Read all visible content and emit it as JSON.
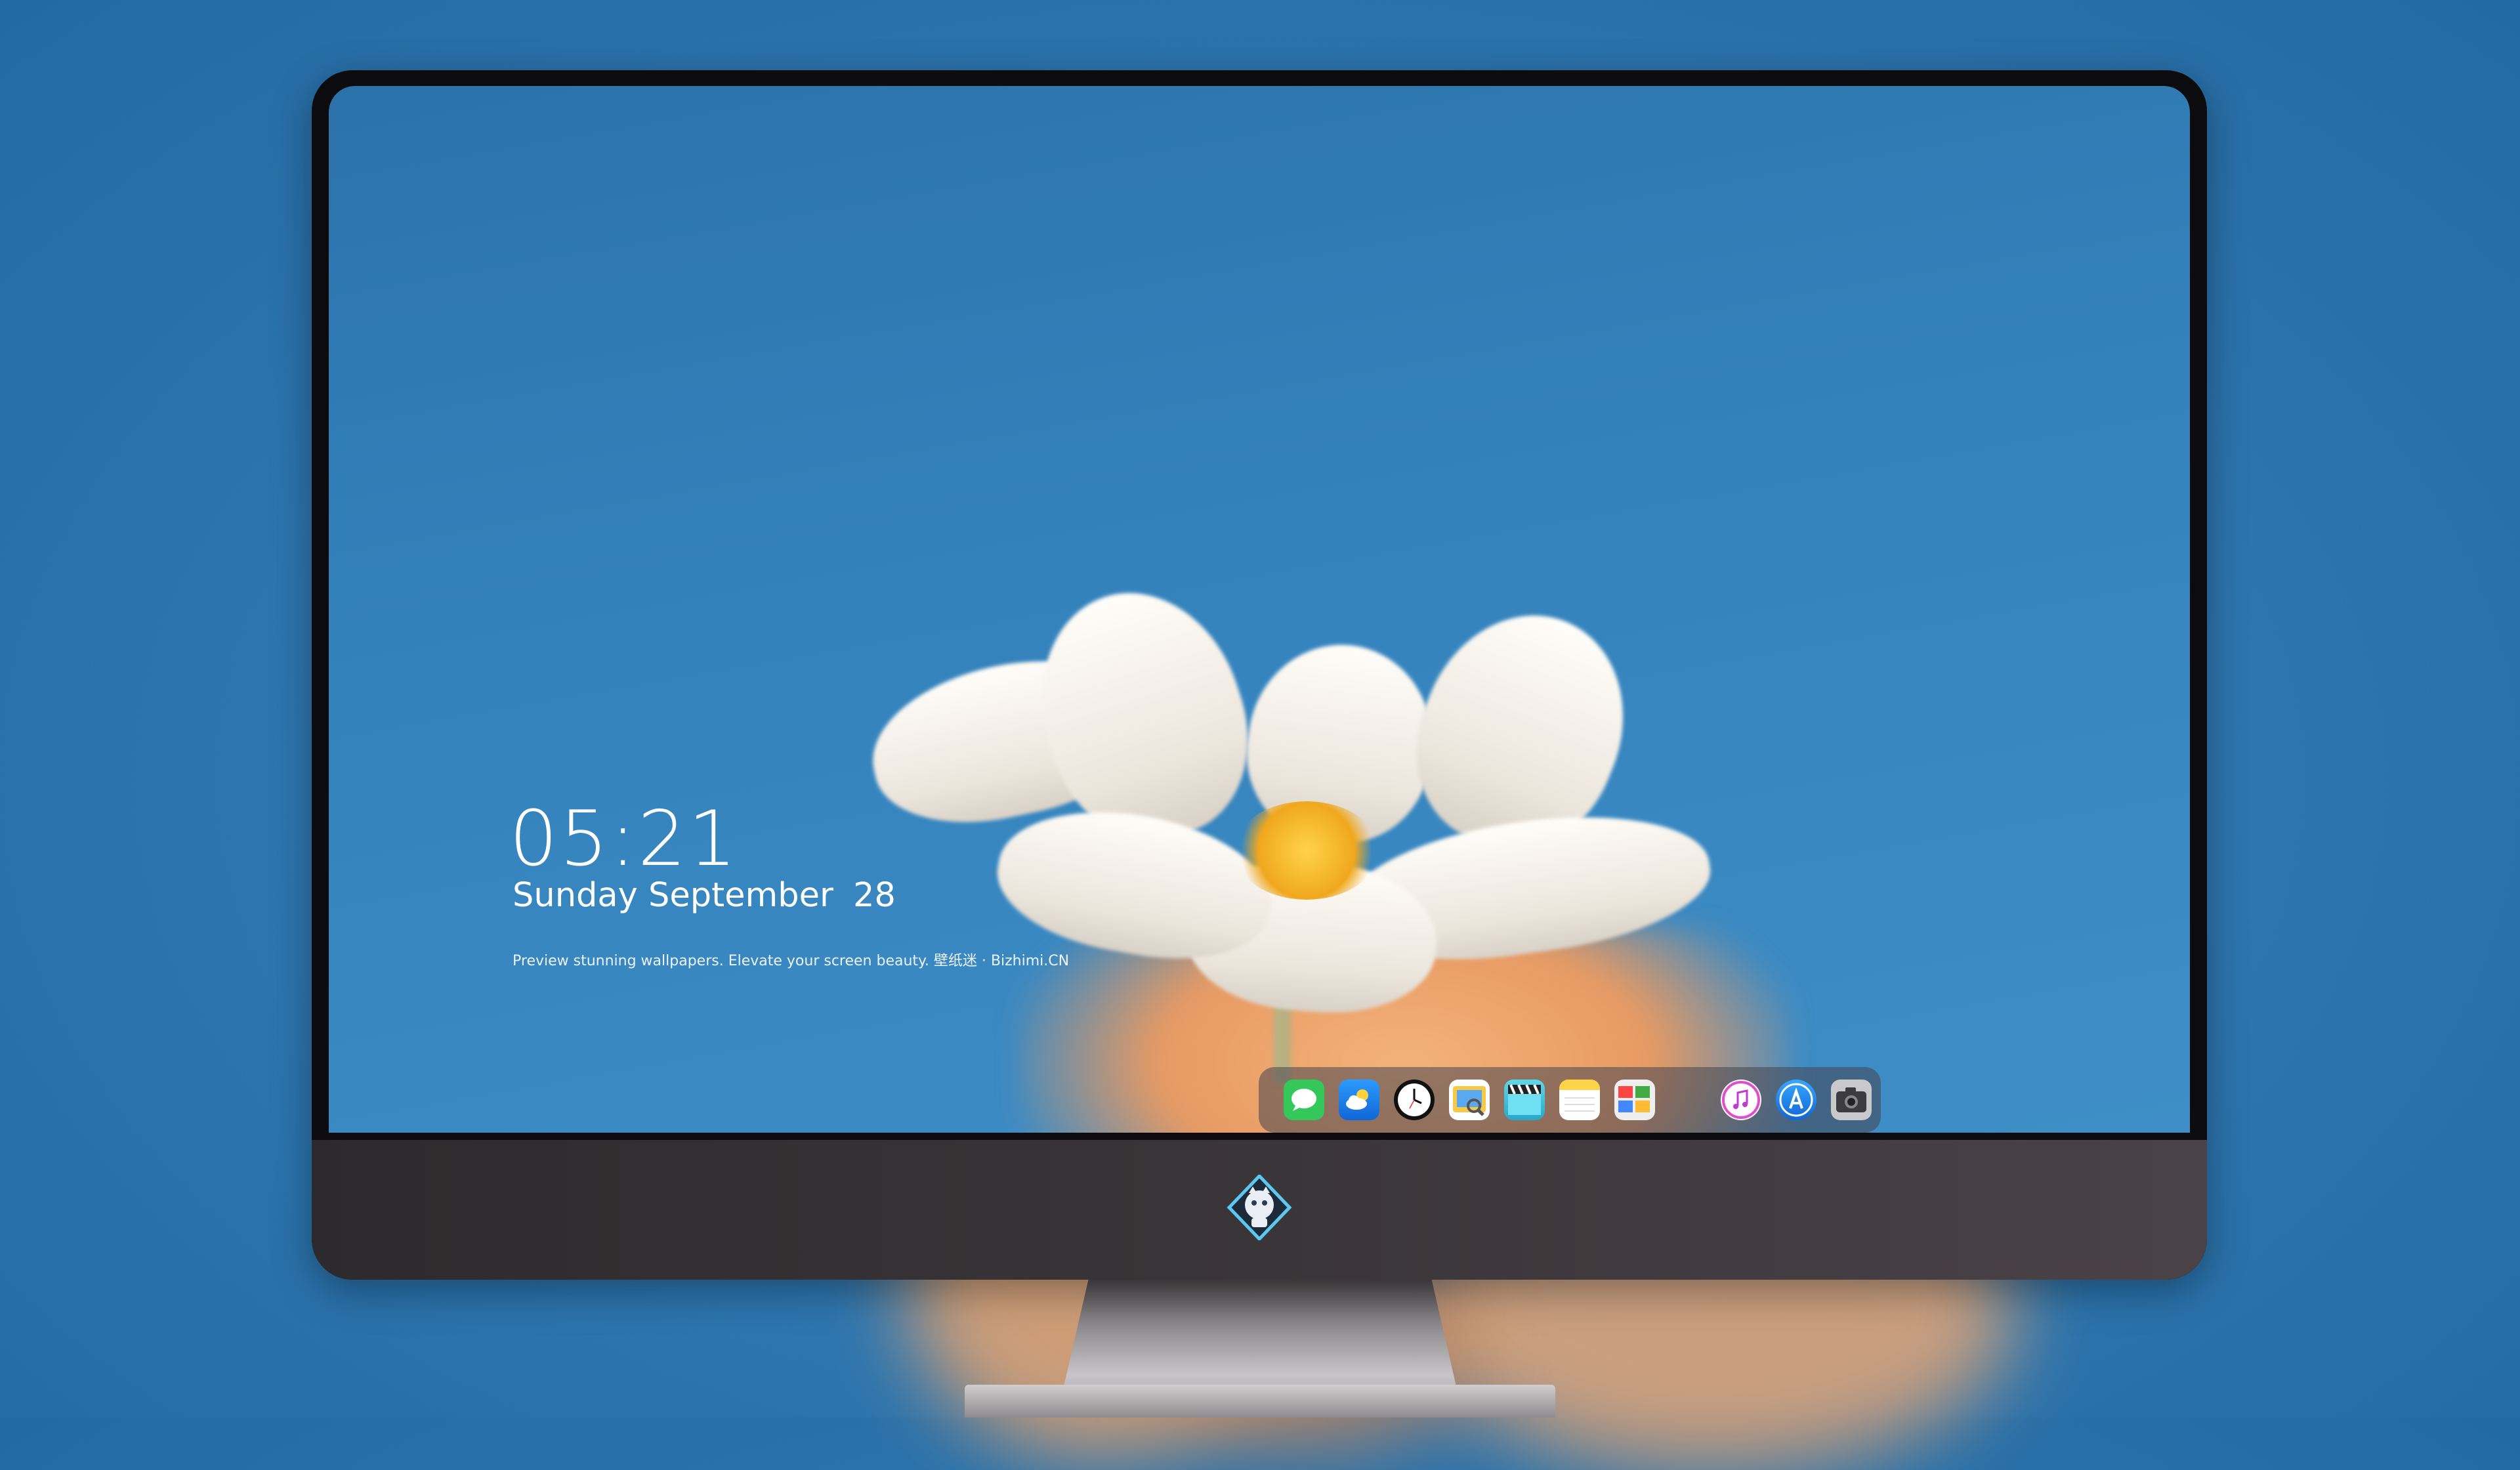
{
  "lockscreen": {
    "time": "05:21",
    "weekday_month": "Sunday September",
    "day": "28",
    "tagline": "Preview stunning wallpapers. Elevate your screen beauty. 壁纸迷 · Bizhimi.CN"
  },
  "dock": {
    "apps": [
      {
        "name": "messages-icon",
        "color": "#34c759"
      },
      {
        "name": "weather-icon",
        "color": "#1e8ef0"
      },
      {
        "name": "clock-icon",
        "color": "#111111"
      },
      {
        "name": "preview-icon",
        "color": "#f2b632"
      },
      {
        "name": "video-clips-icon",
        "color": "#46c9e0"
      },
      {
        "name": "notes-icon",
        "color": "#fbd44a"
      },
      {
        "name": "photo-browser-icon",
        "color": "#e0e0e0"
      },
      {
        "name": "itunes-icon",
        "color": "#e04dcd"
      },
      {
        "name": "app-store-icon",
        "color": "#1f8ff5"
      },
      {
        "name": "screenshot-camera-icon",
        "color": "#3c3c3e"
      }
    ]
  },
  "colors": {
    "background": "#2f78b2",
    "sky": "#3381bb",
    "bezel": "#0c0c0e",
    "chin": "#3a3538"
  }
}
